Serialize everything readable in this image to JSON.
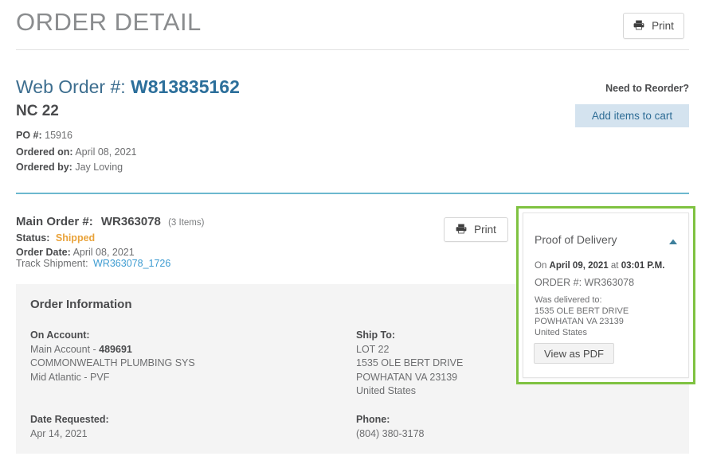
{
  "header": {
    "title": "ORDER DETAIL",
    "print_label": "Print",
    "print_icon": "printer-icon"
  },
  "web_order": {
    "prefix": "Web Order #:",
    "number": "W813835162",
    "name": "NC 22",
    "po_label": "PO #:",
    "po_value": "15916",
    "ordered_on_label": "Ordered on:",
    "ordered_on_value": "April 08, 2021",
    "ordered_by_label": "Ordered by:",
    "ordered_by_value": "Jay Loving"
  },
  "reorder": {
    "label": "Need to Reorder?",
    "button_label": "Add items to cart",
    "button_bg": "#d4e3ef",
    "button_text_color": "#2f6d96"
  },
  "main_order": {
    "prefix": "Main Order #:",
    "number": "WR363078",
    "items_count": "(3 Items)",
    "status_label": "Status:",
    "status_value": "Shipped",
    "status_color": "#e9a33a",
    "order_date_label": "Order Date:",
    "order_date_value": "April 08, 2021",
    "track_label": "Track Shipment:",
    "track_value": "WR363078_1726",
    "track_color": "#3c9bd1",
    "print_label": "Print",
    "print_icon": "printer-icon"
  },
  "order_information": {
    "title": "Order Information",
    "on_account_label": "On Account:",
    "on_account_main": "Main Account - ",
    "on_account_number": "489691",
    "on_account_company": "COMMONWEALTH PLUMBING SYS",
    "on_account_division": "Mid Atlantic - PVF",
    "ship_to_label": "Ship To:",
    "ship_to_line1": "LOT 22",
    "ship_to_line2": "1535 OLE BERT DRIVE",
    "ship_to_line3": "POWHATAN VA 23139",
    "ship_to_line4": "United States",
    "date_requested_label": "Date Requested:",
    "date_requested_value": "Apr 14, 2021",
    "phone_label": "Phone:",
    "phone_value": "(804) 380-3178"
  },
  "proof_of_delivery": {
    "title": "Proof of Delivery",
    "toggle_icon": "chevron-up-icon",
    "on_prefix": "On ",
    "on_date": "April 09, 2021",
    "on_at": " at ",
    "on_time": "03:01 P.M.",
    "order_label": "ORDER #: ",
    "order_number": "WR363078",
    "delivered_label": "Was delivered to:",
    "addr_line1": "1535 OLE BERT DRIVE",
    "addr_line2": "POWHATAN VA 23139",
    "addr_line3": "United States",
    "pdf_button_label": "View as PDF",
    "highlight_color": "#7fc241"
  }
}
